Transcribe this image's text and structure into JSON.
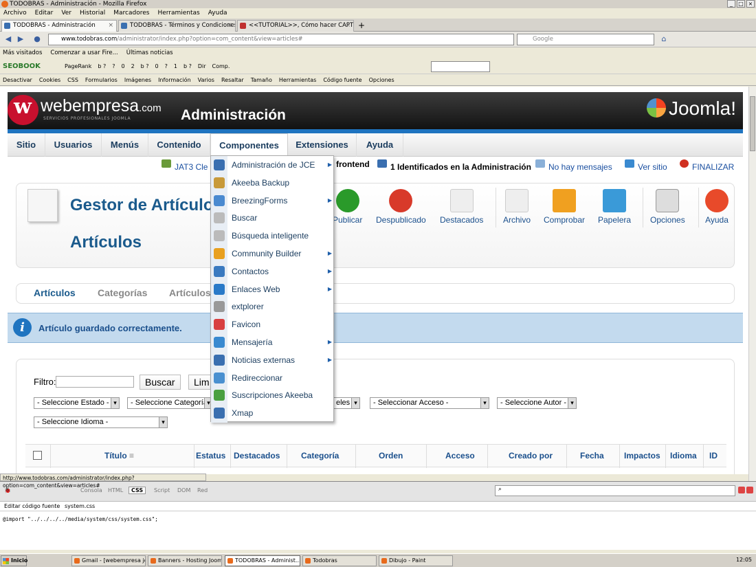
{
  "window": {
    "title": "TODOBRAS - Administración - Mozilla Firefox"
  },
  "menubar": [
    "Archivo",
    "Editar",
    "Ver",
    "Historial",
    "Marcadores",
    "Herramientas",
    "Ayuda"
  ],
  "tabs": [
    {
      "label": "TODOBRAS - Administración"
    },
    {
      "label": "TODOBRAS - Términos y Condiciones"
    },
    {
      "label": "<<TUTORIAL>>, Cómo hacer CAPTURA..."
    }
  ],
  "url": {
    "domain": "www.todobras.com",
    "path": "/administrator/index.php?option=com_content&view=articles#"
  },
  "search": {
    "placeholder": "Google"
  },
  "bookmarks": [
    "Más visitados",
    "Comenzar a usar Fire...",
    "Últimas noticias"
  ],
  "seobar": {
    "logo": "SEOBOOK",
    "items": [
      "PageRank",
      "b ?",
      "?",
      "0",
      "2",
      "b ?",
      "0",
      "?",
      "1",
      "b ?",
      "Dir",
      "Comp."
    ]
  },
  "devbar": [
    "Desactivar",
    "Cookies",
    "CSS",
    "Formularios",
    "Imágenes",
    "Información",
    "Varios",
    "Resaltar",
    "Tamaño",
    "Herramientas",
    "Código fuente",
    "Opciones"
  ],
  "header": {
    "brand": "webempresa",
    "brand_suffix": ".com",
    "tagline": "SERVICIOS PROFESIONALES JOOMLA",
    "title": "Administración",
    "cms": "Joomla!"
  },
  "mainmenu": [
    "Sitio",
    "Usuarios",
    "Menús",
    "Contenido",
    "Componentes",
    "Extensiones",
    "Ayuda"
  ],
  "status": {
    "jat3": "JAT3 Cle",
    "frontend": "frontend",
    "admins": "1 Identificados en la Administración",
    "messages": "No hay mensajes",
    "site": "Ver sitio",
    "logout": "FINALIZAR"
  },
  "page": {
    "title": "Gestor de Artículos",
    "subtitle": "Artículos"
  },
  "toolbar": [
    "Publicar",
    "Despublicado",
    "Destacados",
    "Archivo",
    "Comprobar",
    "Papelera",
    "Opciones",
    "Ayuda"
  ],
  "subtabs": [
    "Artículos",
    "Categorías",
    "Artículos"
  ],
  "message": "Artículo guardado correctamente.",
  "filter": {
    "label": "Filtro:",
    "search": "Buscar",
    "clear": "Lim",
    "value": ""
  },
  "selects": [
    "- Seleccione Estado -",
    "- Seleccione Categoría -",
    "eles -",
    "- Seleccionar Acceso -",
    "- Seleccione Autor -",
    "- Seleccione Idioma -"
  ],
  "columns": [
    "Título",
    "Estatus",
    "Destacados",
    "Categoría",
    "Orden",
    "Acceso",
    "Creado por",
    "Fecha",
    "Impactos",
    "Idioma",
    "ID"
  ],
  "dropdown": [
    {
      "label": "Administración de JCE",
      "sub": true,
      "color": "#3a6fb0"
    },
    {
      "label": "Akeeba Backup",
      "sub": false,
      "color": "#c89a3a"
    },
    {
      "label": "BreezingForms",
      "sub": true,
      "color": "#4a8ad0"
    },
    {
      "label": "Buscar",
      "sub": false,
      "color": "#bbbbbb"
    },
    {
      "label": "Búsqueda inteligente",
      "sub": false,
      "color": "#bbbbbb"
    },
    {
      "label": "Community Builder",
      "sub": true,
      "color": "#e8a020"
    },
    {
      "label": "Contactos",
      "sub": true,
      "color": "#3a7ac0"
    },
    {
      "label": "Enlaces Web",
      "sub": true,
      "color": "#2a7ac8"
    },
    {
      "label": "extplorer",
      "sub": false,
      "color": "#999999"
    },
    {
      "label": "Favicon",
      "sub": false,
      "color": "#d84040"
    },
    {
      "label": "Mensajería",
      "sub": true,
      "color": "#3a8ad0"
    },
    {
      "label": "Noticias externas",
      "sub": true,
      "color": "#3a6fb0"
    },
    {
      "label": "Redireccionar",
      "sub": false,
      "color": "#4a90d0"
    },
    {
      "label": "Suscripciones Akeeba",
      "sub": false,
      "color": "#4aa040"
    },
    {
      "label": "Xmap",
      "sub": false,
      "color": "#3a6fb0"
    }
  ],
  "statusbar_url": "http://www.todobras.com/administrator/index.php?option=com_content&view=articles#",
  "firebug": {
    "tabs": [
      "Consola",
      "HTML",
      "CSS",
      "Script",
      "DOM",
      "Red"
    ],
    "active": "CSS",
    "sub": "Editar código fuente",
    "file": "system.css",
    "code": "@import \"../../../../media/system/css/system.css\";"
  },
  "taskbar": {
    "start": "Inicio",
    "tasks": [
      "Gmail - [webempresa joo...",
      "Banners - Hosting Jooml...",
      "TODOBRAS - Administ...",
      "Todobras",
      "Dibujo - Paint"
    ],
    "clock": "12:05"
  }
}
